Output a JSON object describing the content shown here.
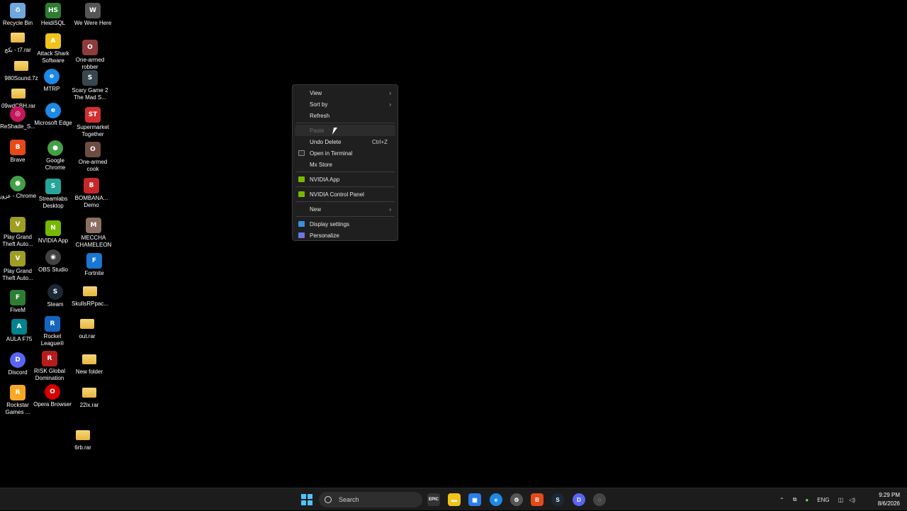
{
  "desktop_icons": [
    {
      "label": "Recycle Bin",
      "icon": "recycle-bin-icon",
      "color": "#6fa8dc",
      "glyph": "♻"
    },
    {
      "label": "HeidiSQL",
      "icon": "heidisql-icon",
      "color": "#2e7d32",
      "glyph": "HS"
    },
    {
      "label": "We Were Here",
      "icon": "game-icon",
      "color": "#555555",
      "glyph": "W"
    },
    {
      "label": "بكج - t7.rar",
      "icon": "folder-icon",
      "color": "#e8b73c",
      "glyph": ""
    },
    {
      "label": "Attack Shark Software",
      "icon": "attack-shark-icon",
      "color": "#f0c419",
      "glyph": "A"
    },
    {
      "label": "One-armed robber",
      "icon": "game-icon",
      "color": "#8e3b3b",
      "glyph": "O"
    },
    {
      "label": "980Sound.7z",
      "icon": "folder-icon",
      "color": "#e8b73c",
      "glyph": ""
    },
    {
      "label": "MTRP",
      "icon": "edge-icon",
      "color": "#1e88e5",
      "glyph": "e"
    },
    {
      "label": "Scary Game 2 The Mad S...",
      "icon": "game-icon",
      "color": "#37474f",
      "glyph": "S"
    },
    {
      "label": "09wdCBH.rar",
      "icon": "folder-icon",
      "color": "#e8b73c",
      "glyph": ""
    },
    {
      "label": "ReShade_S...",
      "icon": "reshade-icon",
      "color": "#c2185b",
      "glyph": "◎"
    },
    {
      "label": "Microsoft Edge",
      "icon": "edge-icon",
      "color": "#1e88e5",
      "glyph": "e"
    },
    {
      "label": "Supermarket Together",
      "icon": "game-icon",
      "color": "#d32f2f",
      "glyph": "ST"
    },
    {
      "label": "Brave",
      "icon": "brave-icon",
      "color": "#e64a19",
      "glyph": "B"
    },
    {
      "label": "Google Chrome",
      "icon": "chrome-icon",
      "color": "#43a047",
      "glyph": "●"
    },
    {
      "label": "One-armed cook",
      "icon": "game-icon",
      "color": "#6d4c41",
      "glyph": "O"
    },
    {
      "label": "عزوز - Chrome",
      "icon": "chrome-icon",
      "color": "#43a047",
      "glyph": "●"
    },
    {
      "label": "Streamlabs Desktop",
      "icon": "streamlabs-icon",
      "color": "#26a69a",
      "glyph": "S"
    },
    {
      "label": "BOMBANA... Demo",
      "icon": "game-icon",
      "color": "#c62828",
      "glyph": "B"
    },
    {
      "label": "Play Grand Theft Auto...",
      "icon": "gta-icon",
      "color": "#9e9d24",
      "glyph": "V"
    },
    {
      "label": "NVIDIA App",
      "icon": "nvidia-icon",
      "color": "#76b900",
      "glyph": "N"
    },
    {
      "label": "MECCHA CHAMELEON",
      "icon": "game-icon",
      "color": "#8d6e63",
      "glyph": "M"
    },
    {
      "label": "Play Grand Theft Auto...",
      "icon": "gta-icon",
      "color": "#9e9d24",
      "glyph": "V"
    },
    {
      "label": "OBS Studio",
      "icon": "obs-icon",
      "color": "#424242",
      "glyph": "◉"
    },
    {
      "label": "Fortnite",
      "icon": "fortnite-icon",
      "color": "#1976d2",
      "glyph": "F"
    },
    {
      "label": "FiveM",
      "icon": "fivem-icon",
      "color": "#2e7d32",
      "glyph": "F"
    },
    {
      "label": "Steam",
      "icon": "steam-icon",
      "color": "#1b2838",
      "glyph": "S"
    },
    {
      "label": "SkullsRPpac...",
      "icon": "folder-icon",
      "color": "#e8b73c",
      "glyph": ""
    },
    {
      "label": "AULA F75",
      "icon": "aula-icon",
      "color": "#00838f",
      "glyph": "A"
    },
    {
      "label": "Rocket League®",
      "icon": "rocket-league-icon",
      "color": "#1565c0",
      "glyph": "R"
    },
    {
      "label": "out.rar",
      "icon": "folder-icon",
      "color": "#e8b73c",
      "glyph": ""
    },
    {
      "label": "Discord",
      "icon": "discord-icon",
      "color": "#5865f2",
      "glyph": "D"
    },
    {
      "label": "RISK Global Domination",
      "icon": "risk-icon",
      "color": "#b71c1c",
      "glyph": "R"
    },
    {
      "label": "New folder",
      "icon": "folder-icon",
      "color": "#e8b73c",
      "glyph": ""
    },
    {
      "label": "Rockstar Games ...",
      "icon": "rockstar-icon",
      "color": "#f9a825",
      "glyph": "R"
    },
    {
      "label": "Opera Browser",
      "icon": "opera-icon",
      "color": "#d50000",
      "glyph": "O"
    },
    {
      "label": "22ix.rar",
      "icon": "folder-icon",
      "color": "#e8b73c",
      "glyph": ""
    },
    {
      "label": "6rb.rar",
      "icon": "folder-icon",
      "color": "#e8b73c",
      "glyph": ""
    }
  ],
  "context_menu": {
    "items": [
      {
        "label": "View",
        "submenu": true
      },
      {
        "label": "Sort by",
        "submenu": true
      },
      {
        "label": "Refresh"
      },
      {
        "label": "Paste",
        "disabled": true
      },
      {
        "label": "Undo Delete",
        "shortcut": "Ctrl+Z"
      },
      {
        "label": "Open in Terminal",
        "icon": "terminal-icon"
      },
      {
        "label": "Mx Store"
      },
      {
        "label": "NVIDIA App",
        "icon": "nvidia-icon"
      },
      {
        "label": "NVIDIA Control Panel",
        "icon": "nvidia-icon"
      },
      {
        "label": "New",
        "submenu": true
      },
      {
        "label": "Display settings",
        "icon": "display-settings-icon"
      },
      {
        "label": "Personalize",
        "icon": "personalize-icon"
      }
    ]
  },
  "taskbar": {
    "search_placeholder": "Search",
    "apps": [
      {
        "name": "epic-games-icon",
        "glyph": "EPIC",
        "color": "#333333"
      },
      {
        "name": "file-explorer-icon",
        "glyph": "▬",
        "color": "#f0c419"
      },
      {
        "name": "microsoft-store-icon",
        "glyph": "▦",
        "color": "#2b7de9"
      },
      {
        "name": "edge-icon",
        "glyph": "e",
        "color": "#1e88e5"
      },
      {
        "name": "settings-icon",
        "glyph": "⚙",
        "color": "#555555"
      },
      {
        "name": "brave-icon",
        "glyph": "B",
        "color": "#e64a19"
      },
      {
        "name": "steam-icon",
        "glyph": "S",
        "color": "#1b2838"
      },
      {
        "name": "discord-icon",
        "glyph": "D",
        "color": "#5865f2"
      },
      {
        "name": "app-icon",
        "glyph": "◌",
        "color": "#444444"
      }
    ],
    "language": "ENG",
    "time": "9:29 PM",
    "date": "8/6/2026"
  },
  "colors": {
    "accent": "#4cc2ff",
    "menu_bg": "#1f1f1f",
    "desktop_bg": "#000000"
  }
}
